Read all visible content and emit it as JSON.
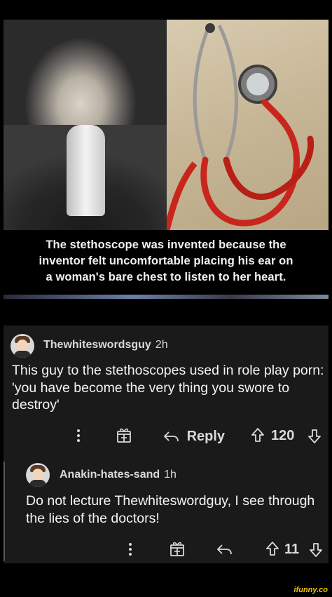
{
  "meme": {
    "caption_lines": [
      "The stethoscope was invented because the",
      "inventor felt uncomfortable placing his ear on",
      "a woman's bare chest to listen to her heart."
    ]
  },
  "comment": {
    "username": "Thewhiteswordsguy",
    "time": "2h",
    "body": "This guy to the stethoscopes used in role play porn: 'you have become the very thing you swore to destroy'",
    "reply_label": "Reply",
    "score": "120"
  },
  "reply": {
    "username": "Anakin-hates-sand",
    "time": "1h",
    "body": "Do not lecture Thewhiteswordguy, I see through the lies of the doctors!",
    "score": "11"
  },
  "watermark": "ifunny.co",
  "colors": {
    "card_bg": "#1a1a1b",
    "text": "#d7dadc",
    "watermark": "#f5c400"
  }
}
